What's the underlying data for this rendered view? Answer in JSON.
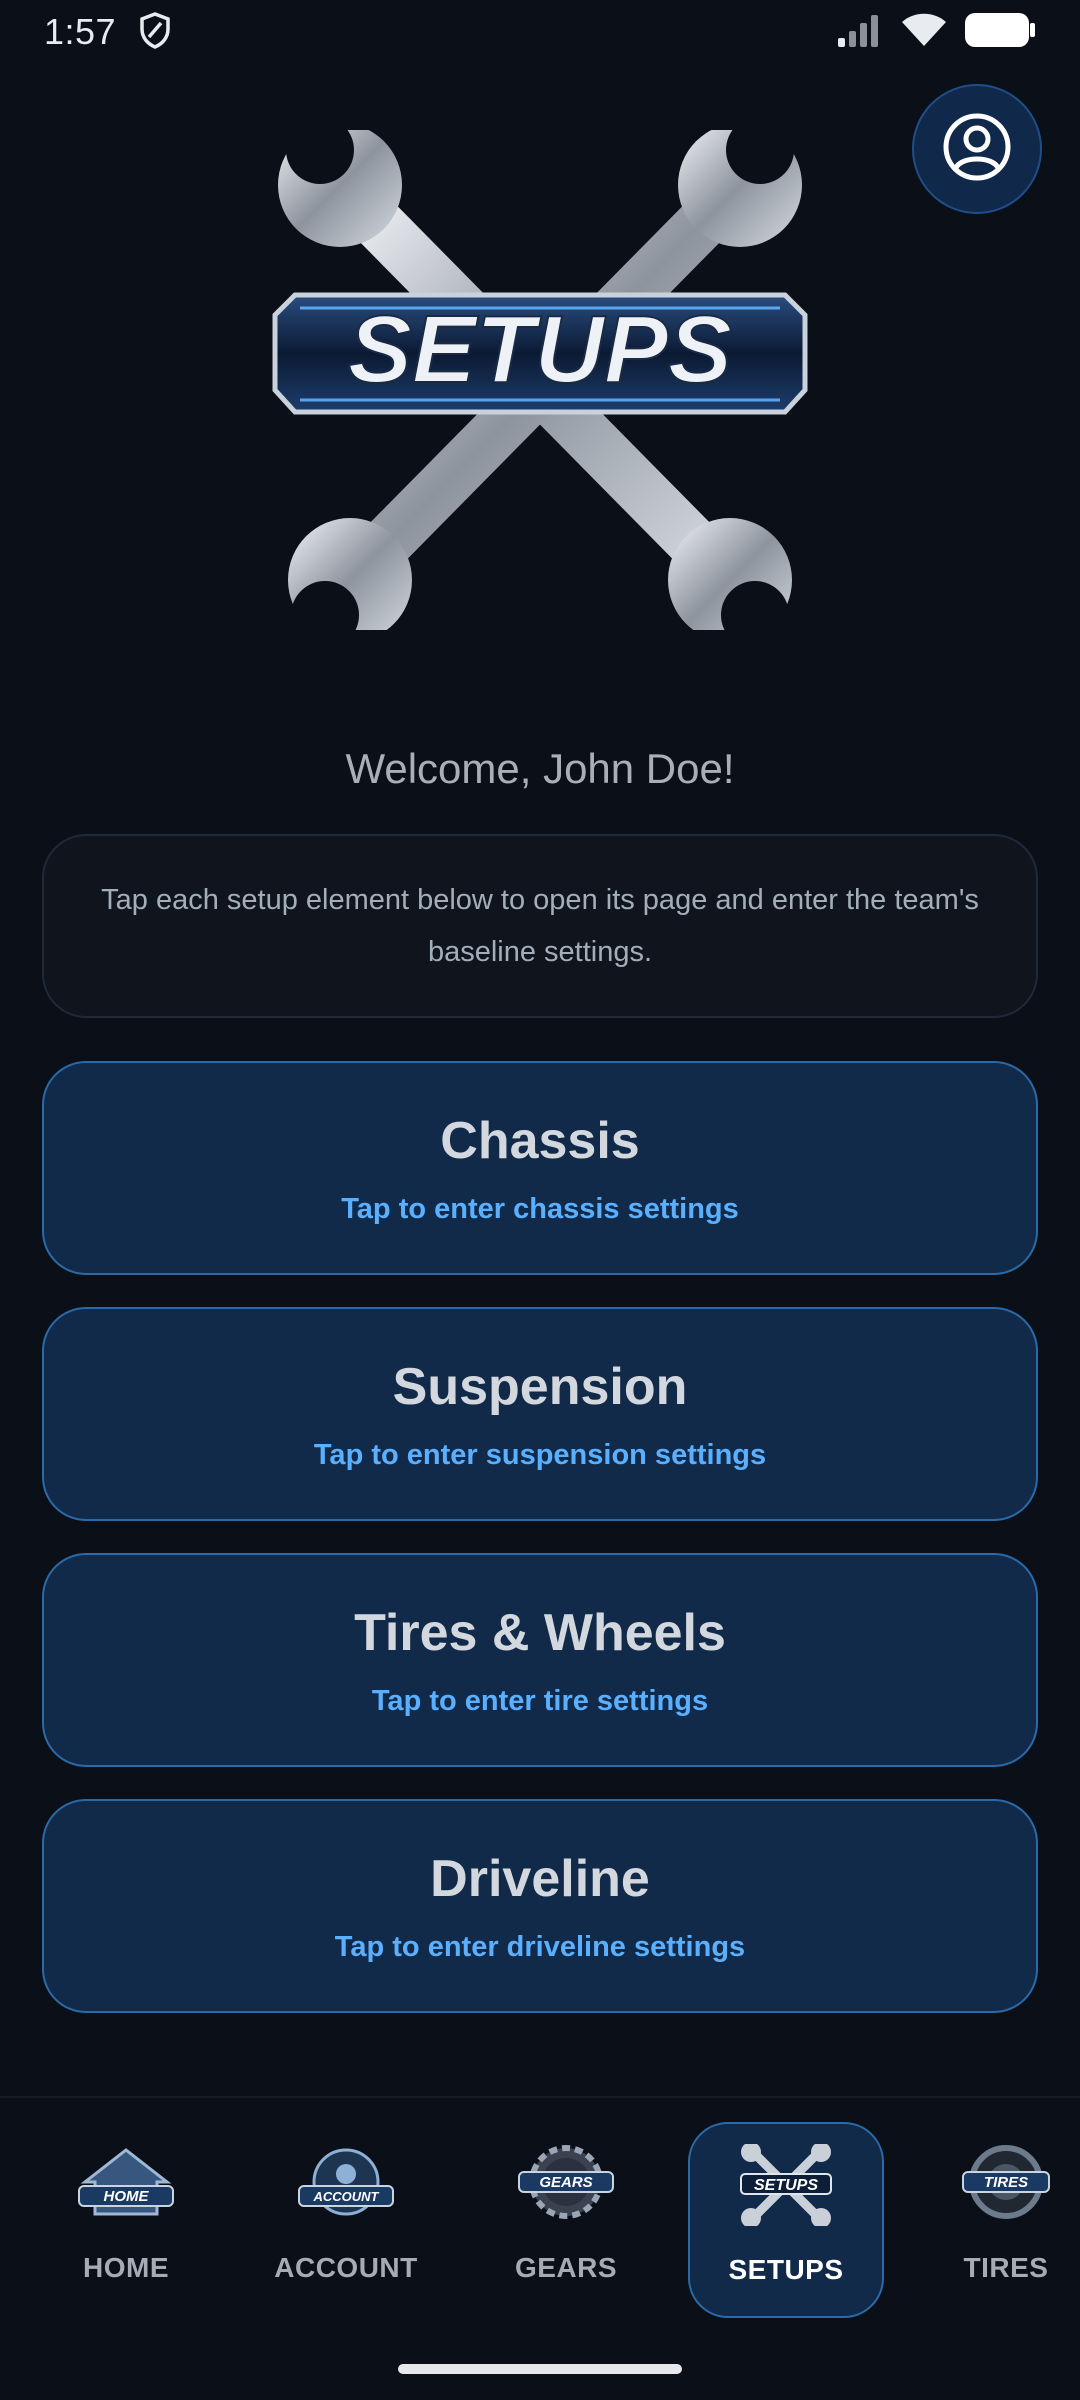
{
  "status_bar": {
    "time": "1:57"
  },
  "logo": {
    "text": "SETUPS"
  },
  "welcome": "Welcome, John Doe!",
  "info": "Tap each setup element below to open its page and enter the team's baseline settings.",
  "setups": [
    {
      "title": "Chassis",
      "subtitle": "Tap to enter chassis settings"
    },
    {
      "title": "Suspension",
      "subtitle": "Tap to enter suspension settings"
    },
    {
      "title": "Tires & Wheels",
      "subtitle": "Tap to enter tire settings"
    },
    {
      "title": "Driveline",
      "subtitle": "Tap to enter driveline settings"
    }
  ],
  "nav": {
    "items": [
      {
        "label": "HOME",
        "icon": "home-icon",
        "badge": "HOME"
      },
      {
        "label": "ACCOUNT",
        "icon": "account-icon",
        "badge": "ACCOUNT"
      },
      {
        "label": "GEARS",
        "icon": "gears-icon",
        "badge": "GEARS"
      },
      {
        "label": "SETUPS",
        "icon": "setups-icon",
        "badge": "SETUPS"
      },
      {
        "label": "TIRES",
        "icon": "tires-icon",
        "badge": "TIRES"
      }
    ],
    "active": "SETUPS"
  },
  "colors": {
    "background": "#0b0f17",
    "card": "#122a4a",
    "accent": "#5ab0ff",
    "border": "#2a6aa8"
  }
}
